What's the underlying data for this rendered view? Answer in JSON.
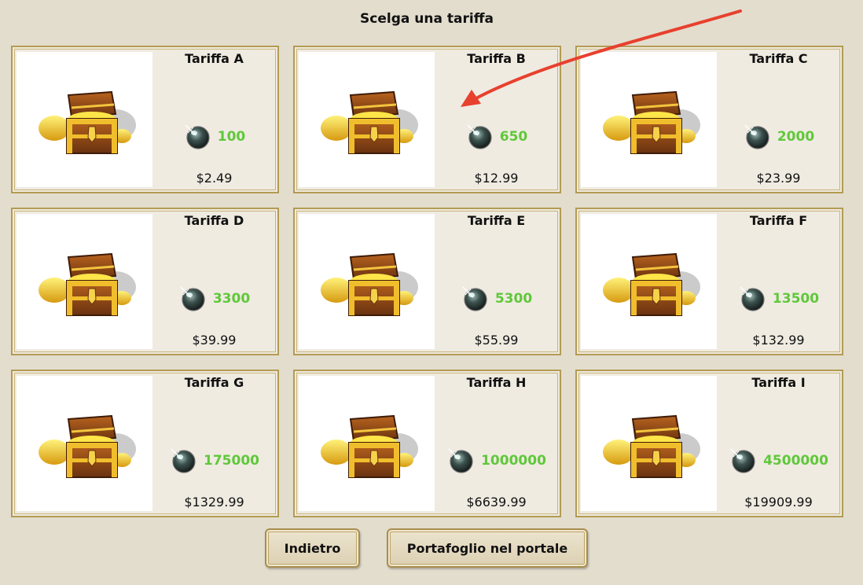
{
  "title": "Scelga una tariffa",
  "cards": [
    {
      "name": "Tariffa A",
      "amount": "100",
      "price": "$2.49"
    },
    {
      "name": "Tariffa B",
      "amount": "650",
      "price": "$12.99"
    },
    {
      "name": "Tariffa C",
      "amount": "2000",
      "price": "$23.99"
    },
    {
      "name": "Tariffa D",
      "amount": "3300",
      "price": "$39.99"
    },
    {
      "name": "Tariffa E",
      "amount": "5300",
      "price": "$55.99"
    },
    {
      "name": "Tariffa F",
      "amount": "13500",
      "price": "$132.99"
    },
    {
      "name": "Tariffa G",
      "amount": "175000",
      "price": "$1329.99"
    },
    {
      "name": "Tariffa H",
      "amount": "1000000",
      "price": "$6639.99"
    },
    {
      "name": "Tariffa I",
      "amount": "4500000",
      "price": "$19909.99"
    }
  ],
  "buttons": {
    "back_label": "Indietro",
    "wallet_label": "Portafoglio nel portale"
  },
  "icons": {
    "chest": "treasure-chest-icon",
    "currency": "gem-icon"
  },
  "colors": {
    "amount": "#5fc83a",
    "annotation_arrow": "#e8402e"
  }
}
